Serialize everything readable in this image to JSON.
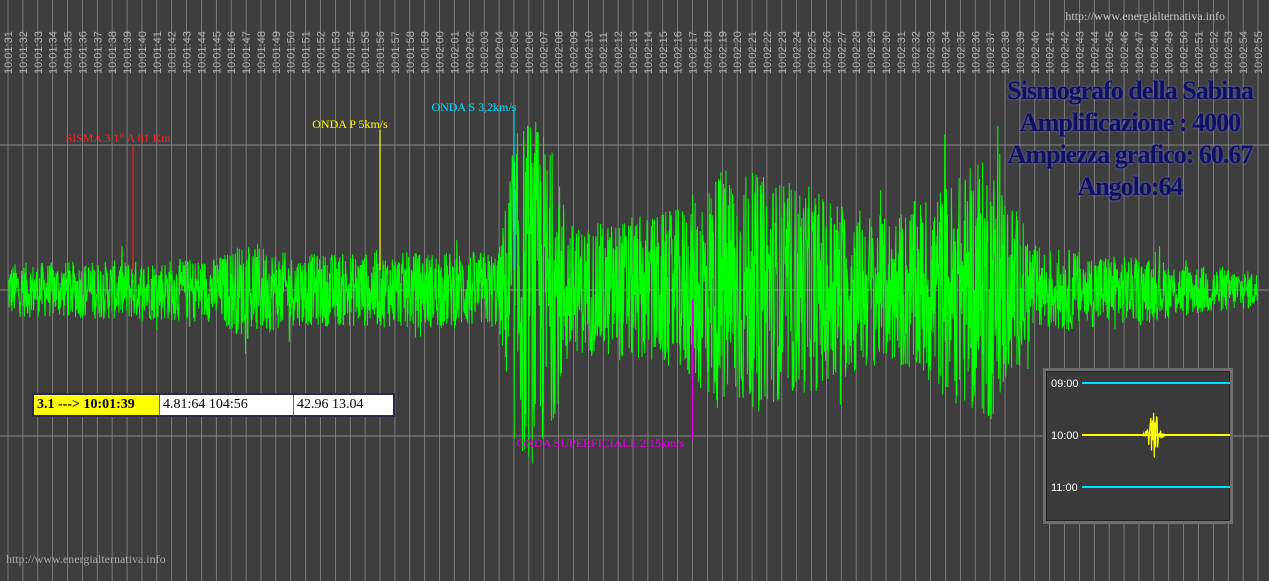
{
  "header": {
    "website_top": "http://www.energialternativa.info",
    "website_bottom": "http://www.energialternativa.info"
  },
  "title_block": {
    "line1": "Sismografo della Sabina",
    "line2": "Amplificazione : 4000",
    "line3": "Ampiezza grafico: 60.67",
    "line4": "Angolo:64"
  },
  "info_box": {
    "magnitude_time": "3.1 ---> 10:01:39",
    "distance": "4.81:64 104:56",
    "coords": "42.96 13.04"
  },
  "colors": {
    "background": "#3e3e3e",
    "signal": "#00ff00",
    "grid": "#8a8a8a",
    "sisma_marker": "#ff2020",
    "p_wave_marker": "#ffff00",
    "s_wave_marker": "#00e0ff",
    "surface_marker": "#e000e0",
    "title_text": "#101060"
  },
  "chart_data": {
    "type": "line",
    "x_unit": "time (hh:mm:ss)",
    "x_range": [
      "10:01:31",
      "10:02:55"
    ],
    "tick_labels": [
      "10:01:31",
      "10:01:32",
      "10:01:33",
      "10:01:34",
      "10:01:35",
      "10:01:36",
      "10:01:37",
      "10:01:38",
      "10:01:39",
      "10:01:40",
      "10:01:41",
      "10:01:42",
      "10:01:43",
      "10:01:44",
      "10:01:45",
      "10:01:46",
      "10:01:47",
      "10:01:48",
      "10:01:49",
      "10:01:50",
      "10:01:51",
      "10:01:52",
      "10:01:53",
      "10:01:54",
      "10:01:55",
      "10:01:56",
      "10:01:57",
      "10:01:58",
      "10:01:59",
      "10:02:00",
      "10:02:01",
      "10:02:02",
      "10:02:03",
      "10:02:04",
      "10:02:05",
      "10:02:06",
      "10:02:07",
      "10:02:08",
      "10:02:09",
      "10:02:10",
      "10:02:11",
      "10:02:12",
      "10:02:13",
      "10:02:14",
      "10:02:15",
      "10:02:16",
      "10:02:17",
      "10:02:18",
      "10:02:19",
      "10:02:20",
      "10:02:21",
      "10:02:22",
      "10:02:23",
      "10:02:24",
      "10:02:25",
      "10:02:26",
      "10:02:27",
      "10:02:28",
      "10:02:29",
      "10:02:30",
      "10:02:31",
      "10:02:32",
      "10:02:33",
      "10:02:34",
      "10:02:35",
      "10:02:36",
      "10:02:37",
      "10:02:38",
      "10:02:39",
      "10:02:40",
      "10:02:41",
      "10:02:42",
      "10:02:43",
      "10:02:44",
      "10:02:45",
      "10:02:46",
      "10:02:47",
      "10:02:48",
      "10:02:49",
      "10:02:50",
      "10:02:51",
      "10:02:52",
      "10:02:53",
      "10:02:54",
      "10:02:55"
    ],
    "grid": true,
    "series": [
      {
        "color": "#00ff00",
        "amplitude_envelope": [
          {
            "t": "10:01:31",
            "a": 0.15
          },
          {
            "t": "10:01:45",
            "a": 0.18
          },
          {
            "t": "10:01:47",
            "a": 0.28
          },
          {
            "t": "10:01:50",
            "a": 0.2
          },
          {
            "t": "10:02:04",
            "a": 0.22
          },
          {
            "t": "10:02:05",
            "a": 0.85
          },
          {
            "t": "10:02:06",
            "a": 1.0
          },
          {
            "t": "10:02:07",
            "a": 0.9
          },
          {
            "t": "10:02:09",
            "a": 0.35
          },
          {
            "t": "10:02:16",
            "a": 0.45
          },
          {
            "t": "10:02:19",
            "a": 0.7
          },
          {
            "t": "10:02:26",
            "a": 0.55
          },
          {
            "t": "10:02:30",
            "a": 0.4
          },
          {
            "t": "10:02:37",
            "a": 0.75
          },
          {
            "t": "10:02:40",
            "a": 0.25
          },
          {
            "t": "10:02:55",
            "a": 0.1
          }
        ]
      }
    ],
    "markers": [
      {
        "label": "SISMA 3.1° A 81 Km",
        "time": "10:01:39",
        "color": "#ff2020"
      },
      {
        "label": "ONDA P 5km/s",
        "time": "10:01:56",
        "color": "#ffff00"
      },
      {
        "label": "ONDA S 3,2km/s",
        "time": "10:02:05",
        "color": "#00e0ff"
      },
      {
        "label": "ONDA SUPERFICIALE 2,15km/s",
        "time": "10:02:17",
        "color": "#e000e0"
      }
    ]
  },
  "mini_chart": {
    "labels": [
      "09:00",
      "10:00",
      "11:00"
    ],
    "line_colors": [
      "#00e0ff",
      "#ffff00",
      "#00e0ff"
    ],
    "event_time": "10:00"
  }
}
